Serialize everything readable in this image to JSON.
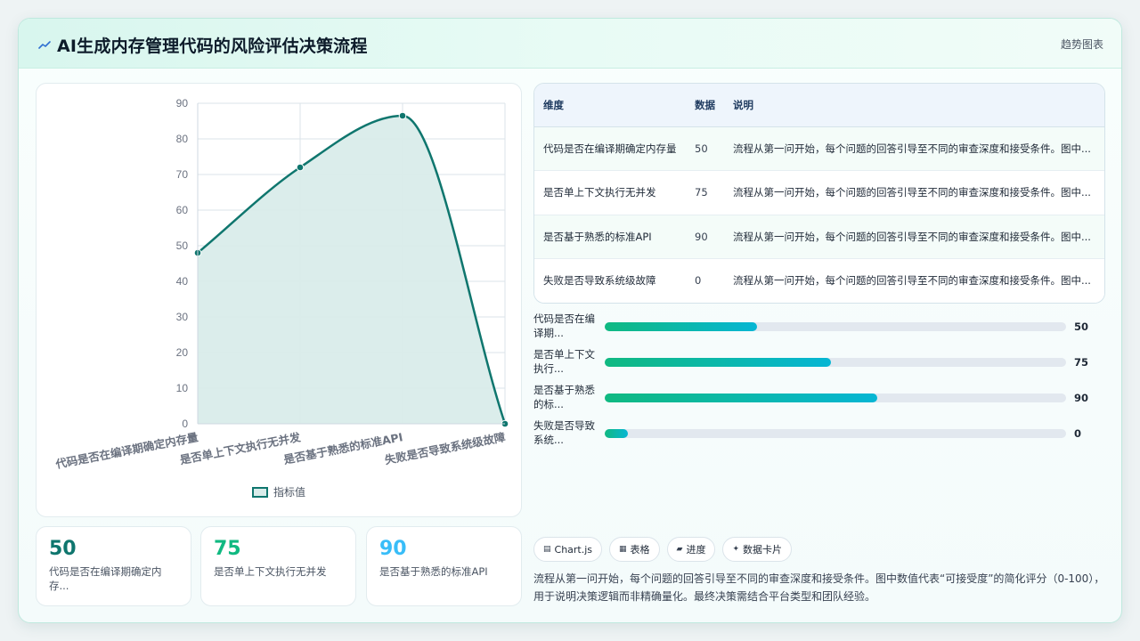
{
  "header": {
    "title_icon": "trend-line-icon",
    "title": "AI生成内存管理代码的风险评估决策流程",
    "right_label": "趋势图表"
  },
  "chart_data": {
    "type": "area",
    "categories": [
      "代码是否在编译期确定内存量",
      "是否单上下文执行无并发",
      "是否基于熟悉的标准API",
      "失败是否导致系统级故障"
    ],
    "series": [
      {
        "name": "指标值",
        "values": [
          48,
          72,
          86.5,
          0
        ]
      }
    ],
    "ylim": [
      0,
      90
    ],
    "yticks": [
      0,
      10,
      20,
      30,
      40,
      50,
      60,
      70,
      80,
      90
    ],
    "grid": true,
    "legend": "bottom",
    "line_color": "#0f766e",
    "fill_color": "#d9ecea",
    "ytick_labels": [
      "0",
      "10",
      "20",
      "30",
      "40",
      "50",
      "60",
      "70",
      "80",
      "90"
    ]
  },
  "stats": [
    {
      "value": "50",
      "label": "代码是否在编译期确定内存...",
      "color": "#0f766e"
    },
    {
      "value": "75",
      "label": "是否单上下文执行无并发",
      "color": "#10b981"
    },
    {
      "value": "90",
      "label": "是否基于熟悉的标准API",
      "color": "#38bdf8"
    }
  ],
  "table": {
    "headers": {
      "dim": "维度",
      "data": "数据",
      "desc": "说明"
    },
    "rows": [
      {
        "dim": "代码是否在编译期确定内存量",
        "data": "50",
        "desc": "流程从第一问开始，每个问题的回答引导至不同的审查深度和接受条件。图中..."
      },
      {
        "dim": "是否单上下文执行无并发",
        "data": "75",
        "desc": "流程从第一问开始，每个问题的回答引导至不同的审查深度和接受条件。图中..."
      },
      {
        "dim": "是否基于熟悉的标准API",
        "data": "90",
        "desc": "流程从第一问开始，每个问题的回答引导至不同的审查深度和接受条件。图中..."
      },
      {
        "dim": "失败是否导致系统级故障",
        "data": "0",
        "desc": "流程从第一问开始，每个问题的回答引导至不同的审查深度和接受条件。图中..."
      }
    ]
  },
  "bars": [
    {
      "label": "代码是否在编译期...",
      "value": "50",
      "fraction": 0.33
    },
    {
      "label": "是否单上下文执行...",
      "value": "75",
      "fraction": 0.49
    },
    {
      "label": "是否基于熟悉的标...",
      "value": "90",
      "fraction": 0.59
    },
    {
      "label": "失败是否导致系统...",
      "value": "0",
      "fraction": 0.05
    }
  ],
  "chips": [
    {
      "icon": "chart-icon",
      "glyph": "▤",
      "label": "Chart.js"
    },
    {
      "icon": "table-icon",
      "glyph": "▦",
      "label": "表格"
    },
    {
      "icon": "progress-icon",
      "glyph": "▰",
      "label": "进度"
    },
    {
      "icon": "card-icon",
      "glyph": "✦",
      "label": "数据卡片"
    }
  ],
  "description": "流程从第一问开始，每个问题的回答引导至不同的审查深度和接受条件。图中数值代表“可接受度”的简化评分（0-100），用于说明决策逻辑而非精确量化。最终决策需结合平台类型和团队经验。"
}
